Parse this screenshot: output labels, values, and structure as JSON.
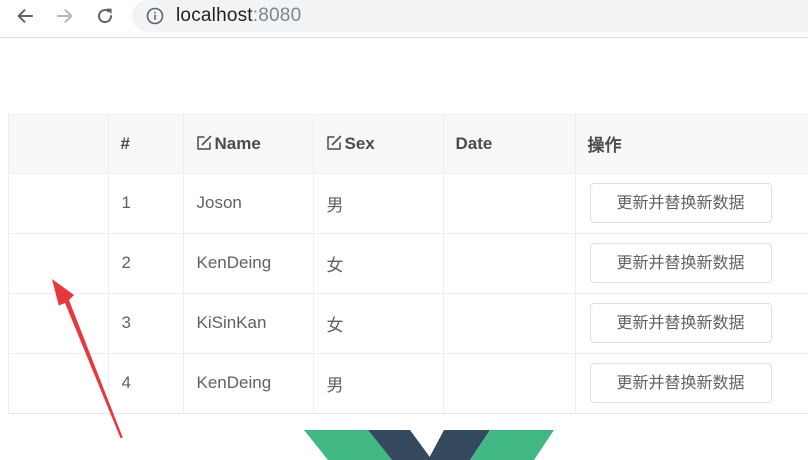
{
  "browser": {
    "url_host": "localhost",
    "url_port": ":8080",
    "icons": [
      "back-arrow-icon",
      "forward-arrow-icon",
      "reload-icon",
      "info-icon"
    ]
  },
  "table": {
    "headers": {
      "selection": "",
      "index": "#",
      "name": "Name",
      "sex": "Sex",
      "date": "Date",
      "actions": "操作"
    },
    "rows": [
      {
        "index": "1",
        "name": "Joson",
        "sex": "男",
        "date": "",
        "action_label": "更新并替换新数据"
      },
      {
        "index": "2",
        "name": "KenDeing",
        "sex": "女",
        "date": "",
        "action_label": "更新并替换新数据"
      },
      {
        "index": "3",
        "name": "KiSinKan",
        "sex": "女",
        "date": "",
        "action_label": "更新并替换新数据"
      },
      {
        "index": "4",
        "name": "KenDeing",
        "sex": "男",
        "date": "",
        "action_label": "更新并替换新数据"
      }
    ]
  },
  "colors": {
    "annotation_arrow": "#e8383d",
    "vue_green": "#41b883",
    "vue_dark": "#34495e"
  }
}
